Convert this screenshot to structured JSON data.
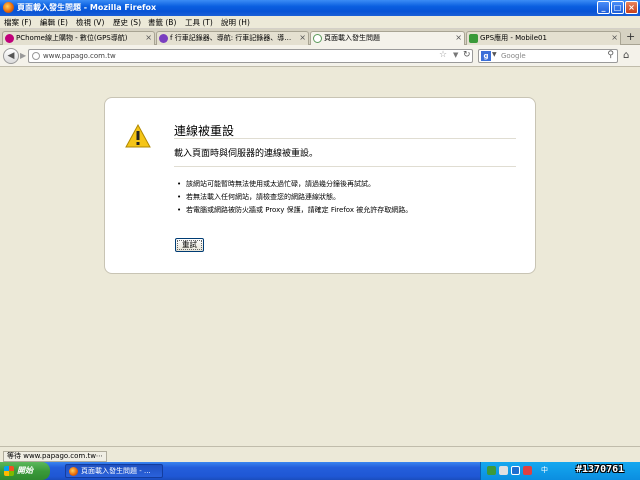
{
  "window": {
    "title": "頁面載入發生問題 - Mozilla Firefox"
  },
  "menu": [
    "檔案 (F)",
    "編輯 (E)",
    "檢視 (V)",
    "歷史 (S)",
    "書籤 (B)",
    "工具 (T)",
    "說明 (H)"
  ],
  "tabs": [
    {
      "label": "PChome線上購物 - 數位(GPS導航)",
      "icon_color": "#c0007a",
      "active": false
    },
    {
      "label": "f 行車記錄器、導航: 行車記錄器、導…",
      "icon_color": "#7a3fc0",
      "active": false
    },
    {
      "label": "頁面載入發生問題",
      "icon_color": "#5a9a5a",
      "active": true
    },
    {
      "label": "GPS應用 - Mobile01",
      "icon_color": "#3a9a3a",
      "active": false
    }
  ],
  "new_tab": "+",
  "nav": {
    "url": "www.papago.com.tw",
    "search_placeholder": "Google"
  },
  "error": {
    "title": "連線被重設",
    "description": "載入頁面時與伺服器的連線被重設。",
    "items": [
      "該網站可能暫時無法使用或太過忙碌，請過幾分鐘後再試試。",
      "若無法載入任何網站，請檢查您的網路連線狀態。",
      "若電腦或網路被防火牆或 Proxy 保護，請確定 Firefox 被允許存取網路。"
    ],
    "retry_label": "重試"
  },
  "status": {
    "text": "等待 www.papago.com.tw⋯"
  },
  "taskbar": {
    "start_label": "開始",
    "item_label": "頁面載入發生問題 - ...",
    "ime_label": "中"
  },
  "watermark": "#1370761",
  "colors": {
    "titlebar": "#0a5fe0",
    "content_bg": "#ece9d8",
    "error_box_bg": "#ffffff",
    "taskbar": "#245edc",
    "start_button": "#3a9a3a"
  }
}
